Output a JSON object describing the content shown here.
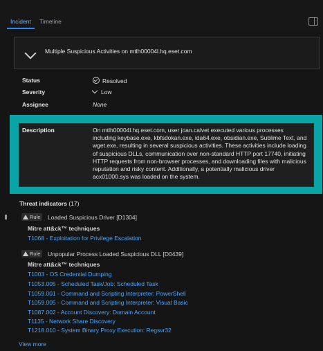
{
  "tabs": [
    {
      "label": "Incident",
      "active": true
    },
    {
      "label": "Timeline",
      "active": false
    }
  ],
  "incident": {
    "title": "Multiple Suspicious Activities on mtlh00004l.hq.eset.com",
    "status_label": "Status",
    "status_value": "Resolved",
    "severity_label": "Severity",
    "severity_value": "Low",
    "assignee_label": "Assignee",
    "assignee_value": "None",
    "description_label": "Description",
    "description_text": "On mtlh00004l.hq.eset.com, user joan.calvet executed various processes including keybase.exe, kbfsdokan.exe, ida64.exe, obsidian.exe, Sublime Text, and wget.exe, resulting in several suspicious activities. These activities include loading of suspicious DLLs, communication over non-standard HTTP port 17740, initiating HTTP requests from non-browser processes, and downloading files with malicious reputation and risky content. Additionally, a potentially malicious driver acx01000.sys was loaded on the system."
  },
  "threat_indicators": {
    "label": "Threat indicators",
    "count": "(17)",
    "rules": [
      {
        "badge": "Rule",
        "title": "Loaded Suspicious Driver [D1304]",
        "mitre_label": "Mitre att&ck™ techniques",
        "techniques": [
          "T1068 - Exploitation for Privilege Escalation"
        ]
      },
      {
        "badge": "Rule",
        "title": "Unpopular Process Loaded Suspicious DLL [D0439]",
        "mitre_label": "Mitre att&ck™ techniques",
        "techniques": [
          "T1003 - OS Credential Dumping",
          "T1053.005 - Scheduled Task/Job: Scheduled Task",
          "T1059.001 - Command and Scripting Interpreter: PowerShell",
          "T1059.005 - Command and Scripting Interpreter: Visual Basic",
          "T1087.002 - Account Discovery: Domain Account",
          "T1135 - Network Share Discovery",
          "T1218.010 - System Binary Proxy Execution: Regsvr32"
        ]
      }
    ],
    "view_more": "View more"
  },
  "colors": {
    "accent": "#4aa8ff",
    "highlight": "#0aa3a6",
    "background": "#151515"
  },
  "icons": [
    "chevron-down-icon",
    "check-circle-icon",
    "warning-icon",
    "panel-toggle-icon"
  ]
}
